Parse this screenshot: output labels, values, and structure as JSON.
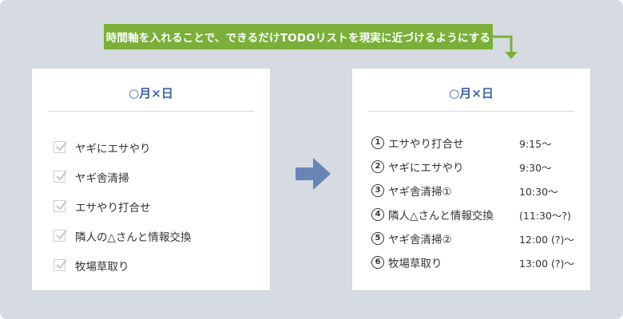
{
  "banner": {
    "text": "時間軸を入れることで、できるだけTODOリストを現実に近づけるようにする"
  },
  "colors": {
    "banner": "#7ab03a",
    "title": "#3e64a8",
    "arrow": "#6885b5",
    "background": "#d6dbe2"
  },
  "left_card": {
    "title": "○月×日",
    "items": [
      {
        "label": "ヤギにエサやり",
        "checked": true
      },
      {
        "label": "ヤギ舎清掃",
        "checked": true
      },
      {
        "label": "エサやり打合せ",
        "checked": true
      },
      {
        "label": "隣人の△さんと情報交換",
        "checked": true
      },
      {
        "label": "牧場草取り",
        "checked": true
      }
    ]
  },
  "right_card": {
    "title": "○月×日",
    "items": [
      {
        "num": "1",
        "task": "エサやり打合せ",
        "time": "9:15〜"
      },
      {
        "num": "2",
        "task": "ヤギにエサやり",
        "time": "9:30〜"
      },
      {
        "num": "3",
        "task": "ヤギ舎清掃①",
        "time": "10:30〜"
      },
      {
        "num": "4",
        "task": "隣人△さんと情報交換",
        "time": "(11:30〜?)"
      },
      {
        "num": "5",
        "task": "ヤギ舎清掃②",
        "time": "12:00 (?)〜"
      },
      {
        "num": "6",
        "task": "牧場草取り",
        "time": "13:00 (?)〜"
      }
    ]
  },
  "icons": {
    "checkbox": "checkmark-icon",
    "connector": "elbow-arrow-icon",
    "transition": "right-arrow-icon"
  }
}
